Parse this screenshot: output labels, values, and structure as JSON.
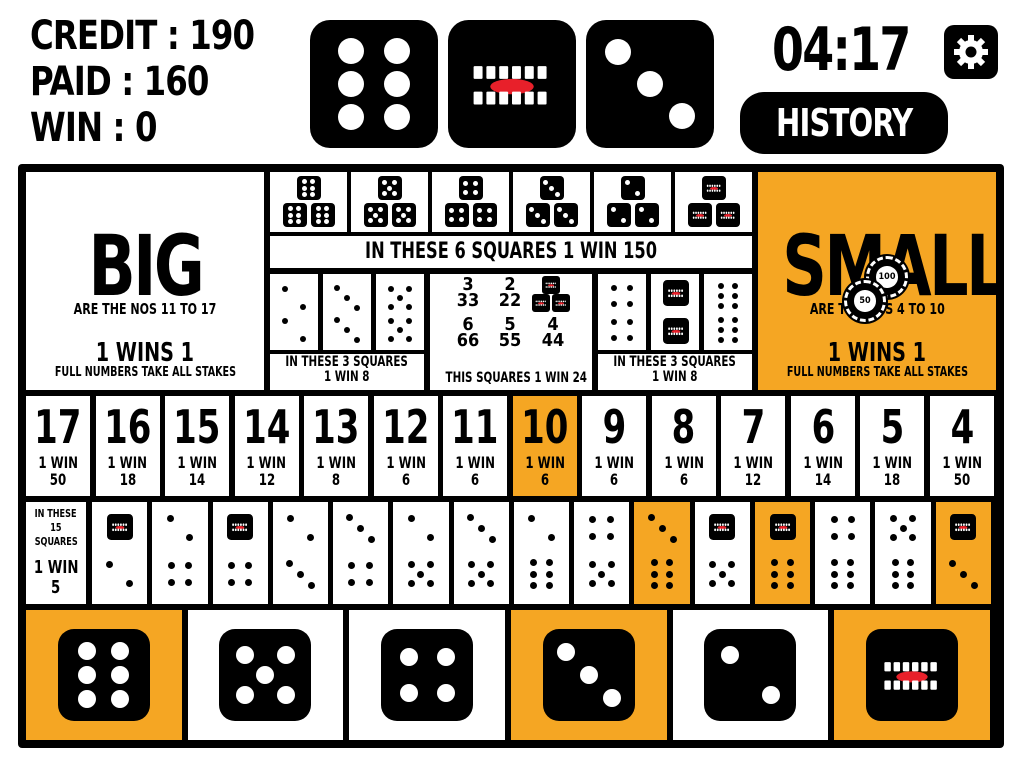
{
  "header": {
    "credit": "CREDIT : 190",
    "paid": "PAID : 160",
    "win": "WIN : 0",
    "timer": "04:17",
    "history_label": "HISTORY",
    "result_dice": [
      6,
      1,
      3
    ]
  },
  "board": {
    "big": {
      "title": "BIG",
      "subtitle": "ARE THE NOS 11 TO 17",
      "payout": "1 WINS 1",
      "note": "FULL NUMBERS TAKE ALL STAKES"
    },
    "small": {
      "title": "SMALL",
      "subtitle": "ARE THE NOS 4 TO 10",
      "payout": "1 WINS 1",
      "note": "FULL NUMBERS TAKE ALL STAKES",
      "chips": [
        "100",
        "50"
      ]
    },
    "triples_label": "IN THESE 6 SQUARES 1 WIN 150",
    "triples": [
      6,
      5,
      4,
      3,
      2,
      1
    ],
    "doubles_left_label_1": "IN THESE 3 SQUARES",
    "doubles_left_label_2": "1 WIN 8",
    "doubles_right_label_1": "IN THESE 3 SQUARES",
    "doubles_right_label_2": "1 WIN 8",
    "doubles_left": [
      2,
      3,
      5
    ],
    "doubles_right": [
      4,
      1,
      6
    ],
    "any_triple": {
      "rows": [
        [
          "3",
          "2",
          ""
        ],
        [
          "33",
          "22",
          ""
        ],
        [
          "6",
          "5",
          "4"
        ],
        [
          "66",
          "55",
          "44"
        ]
      ],
      "label": "THIS SQUARES 1 WIN 24"
    },
    "totals": [
      {
        "n": "17",
        "pay": "1 WIN",
        "odds": "50"
      },
      {
        "n": "16",
        "pay": "1 WIN",
        "odds": "18"
      },
      {
        "n": "15",
        "pay": "1 WIN",
        "odds": "14"
      },
      {
        "n": "14",
        "pay": "1 WIN",
        "odds": "12"
      },
      {
        "n": "13",
        "pay": "1 WIN",
        "odds": "8"
      },
      {
        "n": "12",
        "pay": "1 WIN",
        "odds": "6"
      },
      {
        "n": "11",
        "pay": "1 WIN",
        "odds": "6"
      },
      {
        "n": "10",
        "pay": "1 WIN",
        "odds": "6"
      },
      {
        "n": "9",
        "pay": "1 WIN",
        "odds": "6"
      },
      {
        "n": "8",
        "pay": "1 WIN",
        "odds": "6"
      },
      {
        "n": "7",
        "pay": "1 WIN",
        "odds": "12"
      },
      {
        "n": "6",
        "pay": "1 WIN",
        "odds": "14"
      },
      {
        "n": "5",
        "pay": "1 WIN",
        "odds": "18"
      },
      {
        "n": "4",
        "pay": "1 WIN",
        "odds": "50"
      }
    ],
    "totals_highlight": 7,
    "combos_label": [
      "IN THESE",
      "15",
      "SQUARES",
      "1 WIN",
      "5"
    ],
    "combos": [
      [
        1,
        2
      ],
      [
        2,
        4
      ],
      [
        1,
        4
      ],
      [
        2,
        3
      ],
      [
        3,
        4
      ],
      [
        2,
        5
      ],
      [
        3,
        5
      ],
      [
        2,
        6
      ],
      [
        4,
        5
      ],
      [
        3,
        6
      ],
      [
        1,
        5
      ],
      [
        1,
        6
      ],
      [
        4,
        6
      ],
      [
        5,
        6
      ],
      [
        1,
        3
      ]
    ],
    "combos_highlight": [
      9,
      11,
      14
    ],
    "singles": [
      6,
      5,
      4,
      3,
      2,
      1
    ],
    "singles_highlight": [
      0,
      3,
      5
    ]
  },
  "colors": {
    "accent": "#F5A623",
    "ink": "#000000",
    "paper": "#FFFFFF",
    "mouth": "#E8202A"
  },
  "icons": {
    "settings": "gear-icon",
    "face_die": "laughing-face-die-icon"
  }
}
